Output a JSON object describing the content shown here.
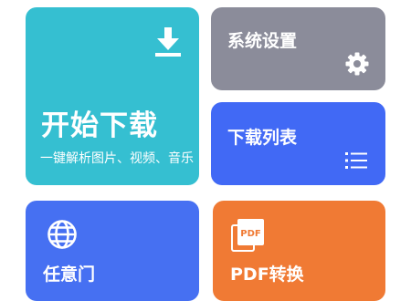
{
  "tiles": {
    "download": {
      "title": "开始下载",
      "subtitle": "一键解析图片、视频、音乐",
      "icon": "download-icon",
      "color": "#35BFD1"
    },
    "settings": {
      "title": "系统设置",
      "icon": "gear-icon",
      "color": "#8B8C9A"
    },
    "list": {
      "title": "下载列表",
      "icon": "list-icon",
      "color": "#4169F5"
    },
    "web": {
      "title": "任意门",
      "icon": "globe-icon",
      "color": "#4670F2"
    },
    "pdf": {
      "title": "PDF转换",
      "icon": "pdf-file-icon",
      "icon_label": "PDF",
      "color": "#F07A34"
    }
  }
}
